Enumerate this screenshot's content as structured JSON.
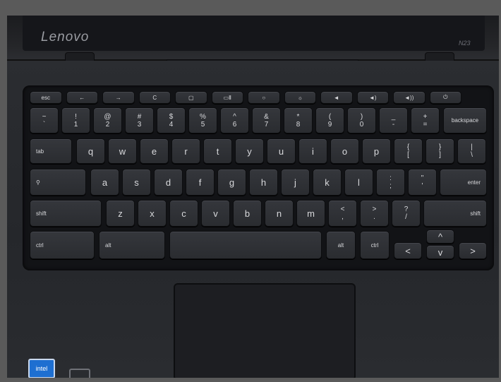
{
  "brand": "Lenovo",
  "model": "N23",
  "badge": "intel",
  "keys": {
    "row0": [
      "esc",
      "←",
      "→",
      "C",
      "▢",
      "▭Ⅱ",
      "○",
      "☼",
      "◄",
      "◄)",
      "◄))",
      "⏻"
    ],
    "row1": [
      {
        "top": "~",
        "bot": "`"
      },
      {
        "top": "!",
        "bot": "1"
      },
      {
        "top": "@",
        "bot": "2"
      },
      {
        "top": "#",
        "bot": "3"
      },
      {
        "top": "$",
        "bot": "4"
      },
      {
        "top": "%",
        "bot": "5"
      },
      {
        "top": "^",
        "bot": "6"
      },
      {
        "top": "&",
        "bot": "7"
      },
      {
        "top": "*",
        "bot": "8"
      },
      {
        "top": "(",
        "bot": "9"
      },
      {
        "top": ")",
        "bot": "0"
      },
      {
        "top": "_",
        "bot": "-"
      },
      {
        "top": "+",
        "bot": "="
      }
    ],
    "backspace": "backspace",
    "tab": "tab",
    "row2": [
      "q",
      "w",
      "e",
      "r",
      "t",
      "y",
      "u",
      "i",
      "o",
      "p"
    ],
    "row2_sym": [
      {
        "top": "{",
        "bot": "["
      },
      {
        "top": "}",
        "bot": "]"
      },
      {
        "top": "|",
        "bot": "\\"
      }
    ],
    "search": "⚲",
    "row3": [
      "a",
      "s",
      "d",
      "f",
      "g",
      "h",
      "j",
      "k",
      "l"
    ],
    "row3_sym": [
      {
        "top": ":",
        "bot": ";"
      },
      {
        "top": "\"",
        "bot": "'"
      }
    ],
    "enter": "enter",
    "shift_l": "shift",
    "row4": [
      "z",
      "x",
      "c",
      "v",
      "b",
      "n",
      "m"
    ],
    "row4_sym": [
      {
        "top": "<",
        "bot": ","
      },
      {
        "top": ">",
        "bot": "."
      },
      {
        "top": "?",
        "bot": "/"
      }
    ],
    "shift_r": "shift",
    "ctrl_l": "ctrl",
    "alt_l": "alt",
    "alt_r": "alt",
    "ctrl_r": "ctrl",
    "arrows": {
      "left": "<",
      "up": "^",
      "down": "v",
      "right": ">"
    }
  }
}
